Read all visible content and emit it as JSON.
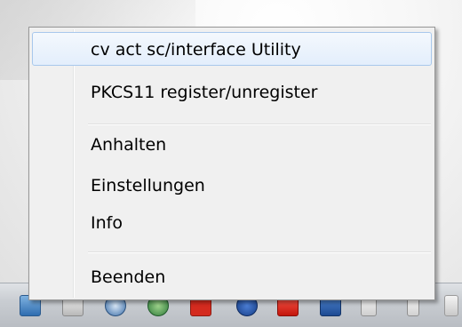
{
  "context_menu": {
    "items": [
      {
        "label": "cv act sc/interface Utility"
      },
      {
        "label": "PKCS11 register/unregister"
      },
      {
        "label": "Anhalten"
      },
      {
        "label": "Einstellungen"
      },
      {
        "label": "Info"
      },
      {
        "label": "Beenden"
      }
    ]
  },
  "taskbar": {
    "tray_icons": [
      "network-drive-icon",
      "keyboard-icon",
      "wireless-icon",
      "monitor-icon",
      "antivirus-icon",
      "bluetooth-icon",
      "pdf-reader-icon",
      "smartcard-icon",
      "flag-icon",
      "battery-icon",
      "signal-icon"
    ]
  },
  "colors": {
    "menu_background": "#f0f0f0",
    "menu_border": "#979797",
    "highlight_background": "#e3eefc",
    "highlight_border": "#a8c8ec",
    "taskbar_background": "#c9cdd2"
  }
}
